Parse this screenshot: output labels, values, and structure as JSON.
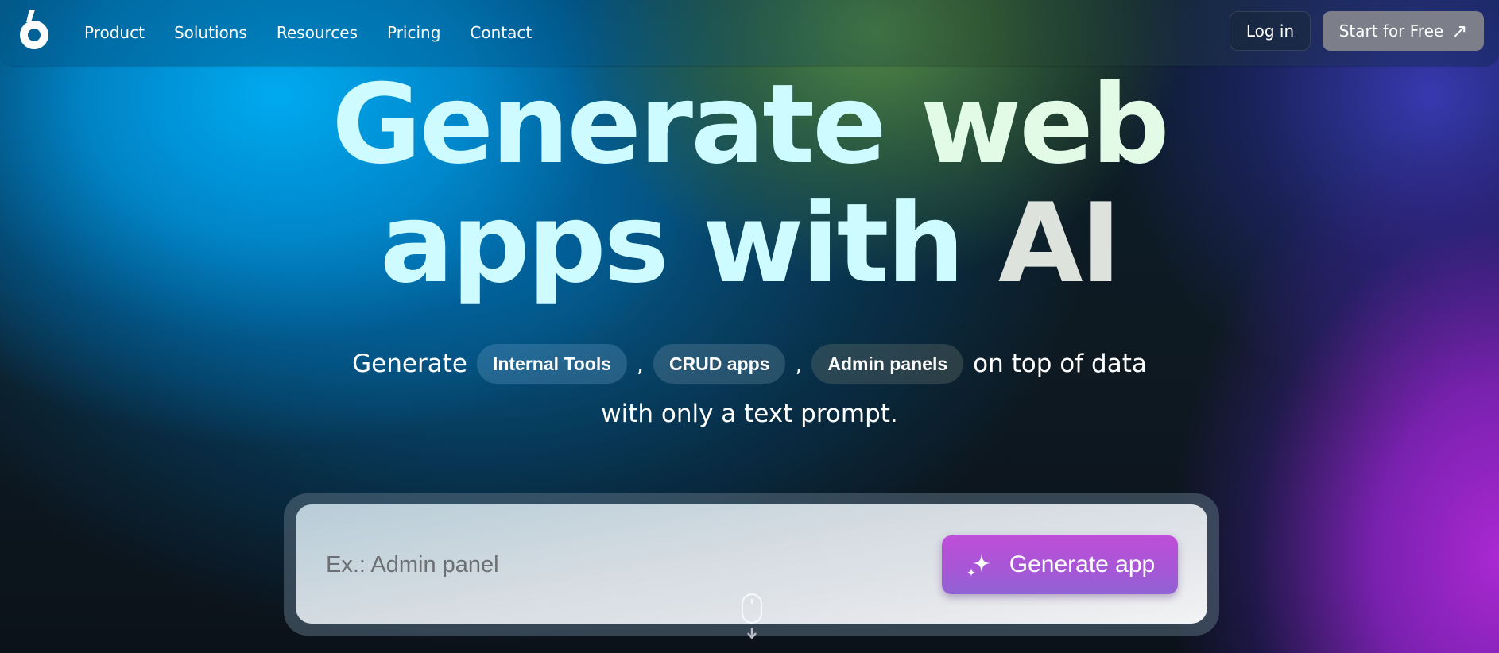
{
  "nav": {
    "logo": "logo-icon",
    "links": [
      "Product",
      "Solutions",
      "Resources",
      "Pricing",
      "Contact"
    ],
    "login_label": "Log in",
    "start_label": "Start for Free",
    "start_arrow": "↗"
  },
  "hero": {
    "title_line1_a": "Generate",
    "title_line1_b": "web",
    "title_line2_a": "apps with",
    "title_line2_b": "AI",
    "subtitle_prefix": "Generate",
    "chips": [
      "Internal Tools",
      "CRUD apps",
      "Admin panels"
    ],
    "separator": ",",
    "subtitle_suffix": "on top of data",
    "subtitle_line2": "with only a text prompt."
  },
  "prompt": {
    "value": "",
    "placeholder": "Ex.: Admin panel",
    "button_label": "Generate app",
    "button_icon": "sparkles-icon"
  },
  "scroll_hint_icon": "mouse-scroll-icon",
  "colors": {
    "accent": "#a657d6",
    "title_text": "#cdfbff",
    "start_button": "#7c7f89"
  }
}
